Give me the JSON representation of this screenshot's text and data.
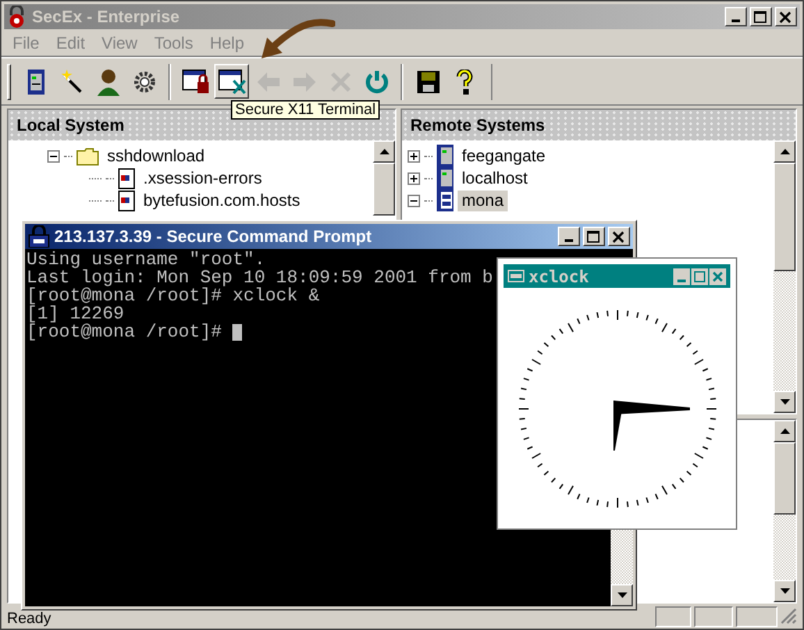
{
  "window": {
    "title": "SecEx - Enterprise"
  },
  "menu": [
    "File",
    "Edit",
    "View",
    "Tools",
    "Help"
  ],
  "toolbar": [
    {
      "buttons": [
        {
          "kind": "server",
          "pressed": false,
          "disabled": false
        },
        {
          "kind": "wand",
          "pressed": false,
          "disabled": false
        },
        {
          "kind": "person",
          "pressed": false,
          "disabled": false
        },
        {
          "kind": "gear",
          "pressed": false,
          "disabled": false
        }
      ]
    },
    {
      "buttons": [
        {
          "kind": "lock-window",
          "pressed": false,
          "disabled": false
        },
        {
          "kind": "x-window",
          "pressed": true,
          "disabled": false
        },
        {
          "kind": "back",
          "pressed": false,
          "disabled": true
        },
        {
          "kind": "forward",
          "pressed": false,
          "disabled": true
        },
        {
          "kind": "stop",
          "pressed": false,
          "disabled": true
        },
        {
          "kind": "power",
          "pressed": false,
          "disabled": false
        }
      ]
    },
    {
      "buttons": [
        {
          "kind": "save",
          "pressed": false,
          "disabled": false
        },
        {
          "kind": "help",
          "pressed": false,
          "disabled": false
        }
      ]
    }
  ],
  "tooltip": {
    "text": "Secure X11 Terminal"
  },
  "local_system": {
    "title": "Local System",
    "tree": [
      {
        "label": "sshdownload",
        "kind": "folder",
        "expanded": true,
        "children": [
          {
            "label": ".xsession-errors",
            "kind": "file"
          },
          {
            "label": "bytefusion.com.hosts",
            "kind": "file"
          }
        ]
      }
    ]
  },
  "remote_systems": {
    "title": "Remote Systems",
    "tree": [
      {
        "label": "feegangate",
        "kind": "server",
        "expanded": false,
        "selected": false
      },
      {
        "label": "localhost",
        "kind": "server",
        "expanded": false,
        "selected": false
      },
      {
        "label": "mona",
        "kind": "sftp",
        "expanded": true,
        "selected": true
      }
    ]
  },
  "terminal": {
    "title": "213.137.3.39 - Secure Command Prompt",
    "lines": [
      "Using username \"root\".",
      "Last login: Mon Sep 10 18:09:59 2001 from b",
      "[root@mona /root]# xclock &",
      "[1] 12269",
      "[root@mona /root]# "
    ],
    "cursor": true
  },
  "xclock": {
    "title": "xclock"
  },
  "status_bar": {
    "text": "Ready"
  }
}
